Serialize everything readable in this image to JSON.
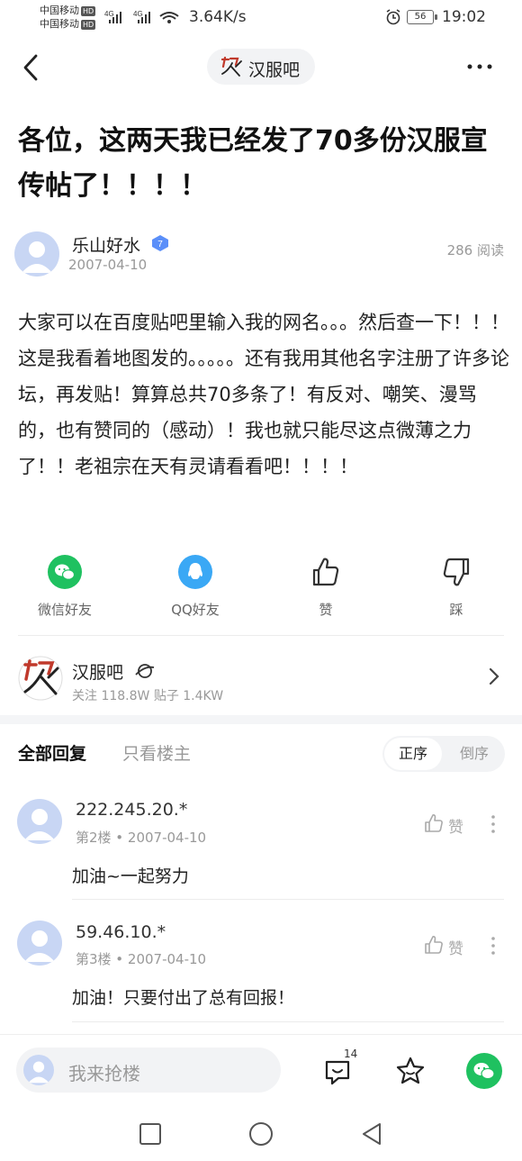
{
  "status_bar": {
    "carrier_1": "中国移动",
    "carrier_2": "中国移动",
    "hd_1": "HD",
    "hd_2": "HD",
    "network_1": "4G",
    "network_2": "4G",
    "speed": "3.64K/s",
    "battery": "56",
    "time": "19:02"
  },
  "nav": {
    "forum_name": "汉服吧"
  },
  "post": {
    "title": "各位，这两天我已经发了70多份汉服宣传帖了！！！！",
    "author": "乐山好水",
    "level_badge": "7",
    "date": "2007-04-10",
    "read_count": "286 阅读",
    "body": "大家可以在百度贴吧里输入我的网名。。。然后查一下！！！这是我看着地图发的。。。。。还有我用其他名字注册了许多论坛，再发贴！算算总共70多条了！有反对、嘲笑、漫骂的，也有赞同的（感动）！我也就只能尽这点微薄之力了！！老祖宗在天有灵请看看吧！！！！"
  },
  "share": {
    "wechat": "微信好友",
    "qq": "QQ好友",
    "like": "赞",
    "dislike": "踩"
  },
  "forum": {
    "name": "汉服吧",
    "stats": "关注 118.8W   贴子 1.4KW"
  },
  "replies_header": {
    "tab_all": "全部回复",
    "tab_host": "只看楼主",
    "sort_asc": "正序",
    "sort_desc": "倒序"
  },
  "replies": [
    {
      "ip": "222.245.20.*",
      "meta": "第2楼 • 2007-04-10",
      "text": "加油~一起努力",
      "like": "赞"
    },
    {
      "ip": "59.46.10.*",
      "meta": "第3楼 • 2007-04-10",
      "text": "加油！只要付出了总有回报！",
      "like": "赞"
    }
  ],
  "bottom_bar": {
    "input_placeholder": "我来抢楼",
    "comment_count": "14"
  },
  "colors": {
    "wechat_green": "#1fc160",
    "qq_blue": "#3aa8f5",
    "avatar_blue": "#c8d6f4",
    "badge_blue": "#5b8ff9"
  }
}
